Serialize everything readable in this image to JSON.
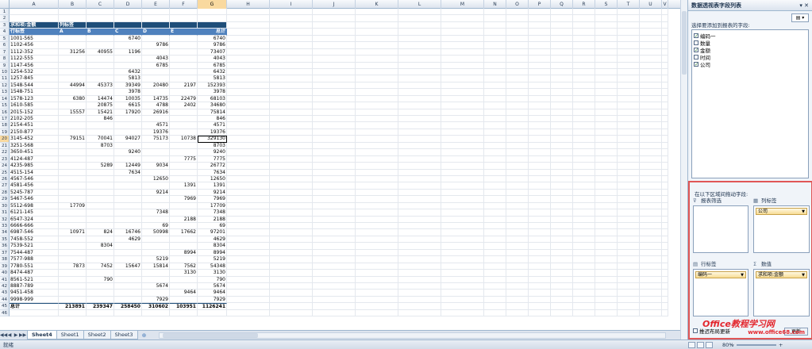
{
  "columns": [
    "A",
    "B",
    "C",
    "D",
    "E",
    "F",
    "G",
    "H",
    "I",
    "J",
    "K",
    "L",
    "M",
    "N",
    "O",
    "P",
    "Q",
    "R",
    "S",
    "T",
    "U",
    "V"
  ],
  "selected_column": "G",
  "selected_row": 20,
  "pivot": {
    "header_label": "求和项:金额",
    "col_label_header": "列标签",
    "row_label_header": "行标签",
    "col_values": [
      "A",
      "B",
      "C",
      "D",
      "E",
      "总计"
    ],
    "rows": [
      [
        "1001-565",
        "",
        "",
        "6740",
        "",
        "",
        "6740"
      ],
      [
        "1102-456",
        "",
        "",
        "",
        "9786",
        "",
        "9786"
      ],
      [
        "1112-352",
        "31256",
        "40955",
        "1196",
        "",
        "",
        "73407"
      ],
      [
        "1122-555",
        "",
        "",
        "",
        "4043",
        "",
        "4043"
      ],
      [
        "1147-456",
        "",
        "",
        "",
        "6785",
        "",
        "6785"
      ],
      [
        "1254-532",
        "",
        "",
        "6432",
        "",
        "",
        "6432"
      ],
      [
        "1257-845",
        "",
        "",
        "5813",
        "",
        "",
        "5813"
      ],
      [
        "1548-544",
        "44994",
        "45373",
        "39349",
        "20480",
        "2197",
        "152393"
      ],
      [
        "1548-751",
        "",
        "",
        "3978",
        "",
        "",
        "3978"
      ],
      [
        "1578-123",
        "6380",
        "14474",
        "10035",
        "14735",
        "22479",
        "68103"
      ],
      [
        "1610-585",
        "",
        "20875",
        "6615",
        "4788",
        "2402",
        "34680"
      ],
      [
        "2015-152",
        "15557",
        "15421",
        "17920",
        "26916",
        "",
        "75814"
      ],
      [
        "2102-205",
        "",
        "846",
        "",
        "",
        "",
        "846"
      ],
      [
        "2154-451",
        "",
        "",
        "",
        "4571",
        "",
        "4571"
      ],
      [
        "2150-877",
        "",
        "",
        "",
        "19376",
        "",
        "19376"
      ],
      [
        "3145-452",
        "79151",
        "70041",
        "94027",
        "75173",
        "10738",
        "329130"
      ],
      [
        "3251-568",
        "",
        "8703",
        "",
        "",
        "",
        "8703"
      ],
      [
        "3650-451",
        "",
        "",
        "9240",
        "",
        "",
        "9240"
      ],
      [
        "4124-487",
        "",
        "",
        "",
        "",
        "7775",
        "7775"
      ],
      [
        "4235-985",
        "",
        "5289",
        "12449",
        "9034",
        "",
        "26772"
      ],
      [
        "4515-154",
        "",
        "",
        "7634",
        "",
        "",
        "7634"
      ],
      [
        "4567-546",
        "",
        "",
        "",
        "12650",
        "",
        "12650"
      ],
      [
        "4581-456",
        "",
        "",
        "",
        "",
        "1391",
        "1391"
      ],
      [
        "5245-787",
        "",
        "",
        "",
        "9214",
        "",
        "9214"
      ],
      [
        "5467-546",
        "",
        "",
        "",
        "",
        "7969",
        "7969"
      ],
      [
        "5512-698",
        "17709",
        "",
        "",
        "",
        "",
        "17709"
      ],
      [
        "6121-145",
        "",
        "",
        "",
        "7348",
        "",
        "7348"
      ],
      [
        "6547-324",
        "",
        "",
        "",
        "",
        "2188",
        "2188"
      ],
      [
        "6666-666",
        "",
        "",
        "",
        "69",
        "",
        "69"
      ],
      [
        "6987-546",
        "10971",
        "824",
        "16746",
        "50998",
        "17662",
        "97201"
      ],
      [
        "7458-552",
        "",
        "",
        "4629",
        "",
        "",
        "4629"
      ],
      [
        "7539-521",
        "",
        "8304",
        "",
        "",
        "",
        "8304"
      ],
      [
        "7544-487",
        "",
        "",
        "",
        "",
        "8994",
        "8994"
      ],
      [
        "7577-988",
        "",
        "",
        "",
        "5219",
        "",
        "5219"
      ],
      [
        "7780-551",
        "7873",
        "7452",
        "15647",
        "15814",
        "7562",
        "54348"
      ],
      [
        "8474-487",
        "",
        "",
        "",
        "",
        "3130",
        "3130"
      ],
      [
        "8561-521",
        "",
        "790",
        "",
        "",
        "",
        "790"
      ],
      [
        "8887-789",
        "",
        "",
        "",
        "5674",
        "",
        "5674"
      ],
      [
        "9451-458",
        "",
        "",
        "",
        "",
        "9464",
        "9464"
      ],
      [
        "9998-999",
        "",
        "",
        "",
        "7929",
        "",
        "7929"
      ]
    ],
    "total_label": "总计",
    "totals": [
      "213891",
      "239347",
      "258450",
      "310602",
      "103951",
      "1126241"
    ]
  },
  "sheet_tabs": [
    "Sheet4",
    "Sheet1",
    "Sheet2",
    "Sheet3"
  ],
  "active_tab": "Sheet4",
  "status": {
    "ready": "就绪",
    "zoom": "80%",
    "minus": "−",
    "plus": "+"
  },
  "panel": {
    "title": "数据透视表字段列表",
    "title_controls": "▾ ✕",
    "layout_btn": "▾",
    "choose_label": "选择要添加到报表的字段:",
    "fields": [
      {
        "name": "编码一",
        "checked": true
      },
      {
        "name": "数量",
        "checked": false
      },
      {
        "name": "金额",
        "checked": true
      },
      {
        "name": "时间",
        "checked": false
      },
      {
        "name": "公司",
        "checked": true
      }
    ],
    "drag_label": "在以下区域间拖动字段:",
    "zones": {
      "filter": {
        "label": "报表筛选",
        "icon": "⊽",
        "items": []
      },
      "columns": {
        "label": "列标签",
        "icon": "▦",
        "items": [
          "公司"
        ]
      },
      "rows": {
        "label": "行标签",
        "icon": "▤",
        "items": [
          "编码一"
        ]
      },
      "values": {
        "label": "数值",
        "icon": "Σ",
        "items": [
          "求和项:金额"
        ]
      }
    },
    "defer_label": "推迟布局更新",
    "update_label": "更新"
  },
  "watermark": {
    "line1": "Office教程学习网",
    "line2": "www.office68.com"
  }
}
